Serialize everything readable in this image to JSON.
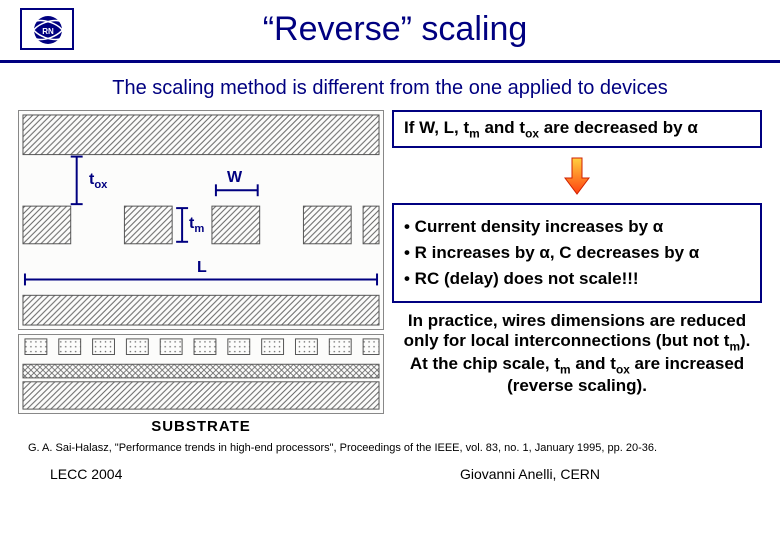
{
  "header": {
    "logo_name": "cern-logo",
    "title": "“Reverse” scaling"
  },
  "subtitle": "The scaling method is different from the one applied to devices",
  "diagram": {
    "labels": {
      "tox": "t",
      "tox_sub": "ox",
      "W": "W",
      "tm": "t",
      "tm_sub": "m",
      "L": "L"
    },
    "substrate_label": "SUBSTRATE"
  },
  "box_if": {
    "text_prefix": "If W, L, t",
    "tm_sub": "m",
    "text_mid": " and t",
    "tox_sub": "ox",
    "text_suffix": " are decreased by α"
  },
  "bullets": [
    "• Current density increases by α",
    "• R increases by α, C decreases by α",
    "• RC (delay) does not scale!!!"
  ],
  "practice": {
    "line1": "In practice, wires dimensions are reduced only for local interconnections (but not t",
    "tm1_sub": "m",
    "line1b": "). At the chip scale, t",
    "tm2_sub": "m",
    "line2": " and t",
    "tox_sub": "ox",
    "line3": " are increased (reverse scaling)."
  },
  "reference": "G. A. Sai-Halasz, \"Performance trends in high-end processors\", Proceedings of the IEEE, vol. 83, no. 1, January 1995, pp. 20-36.",
  "footer": {
    "left": "LECC 2004",
    "center": "Giovanni Anelli, CERN"
  }
}
